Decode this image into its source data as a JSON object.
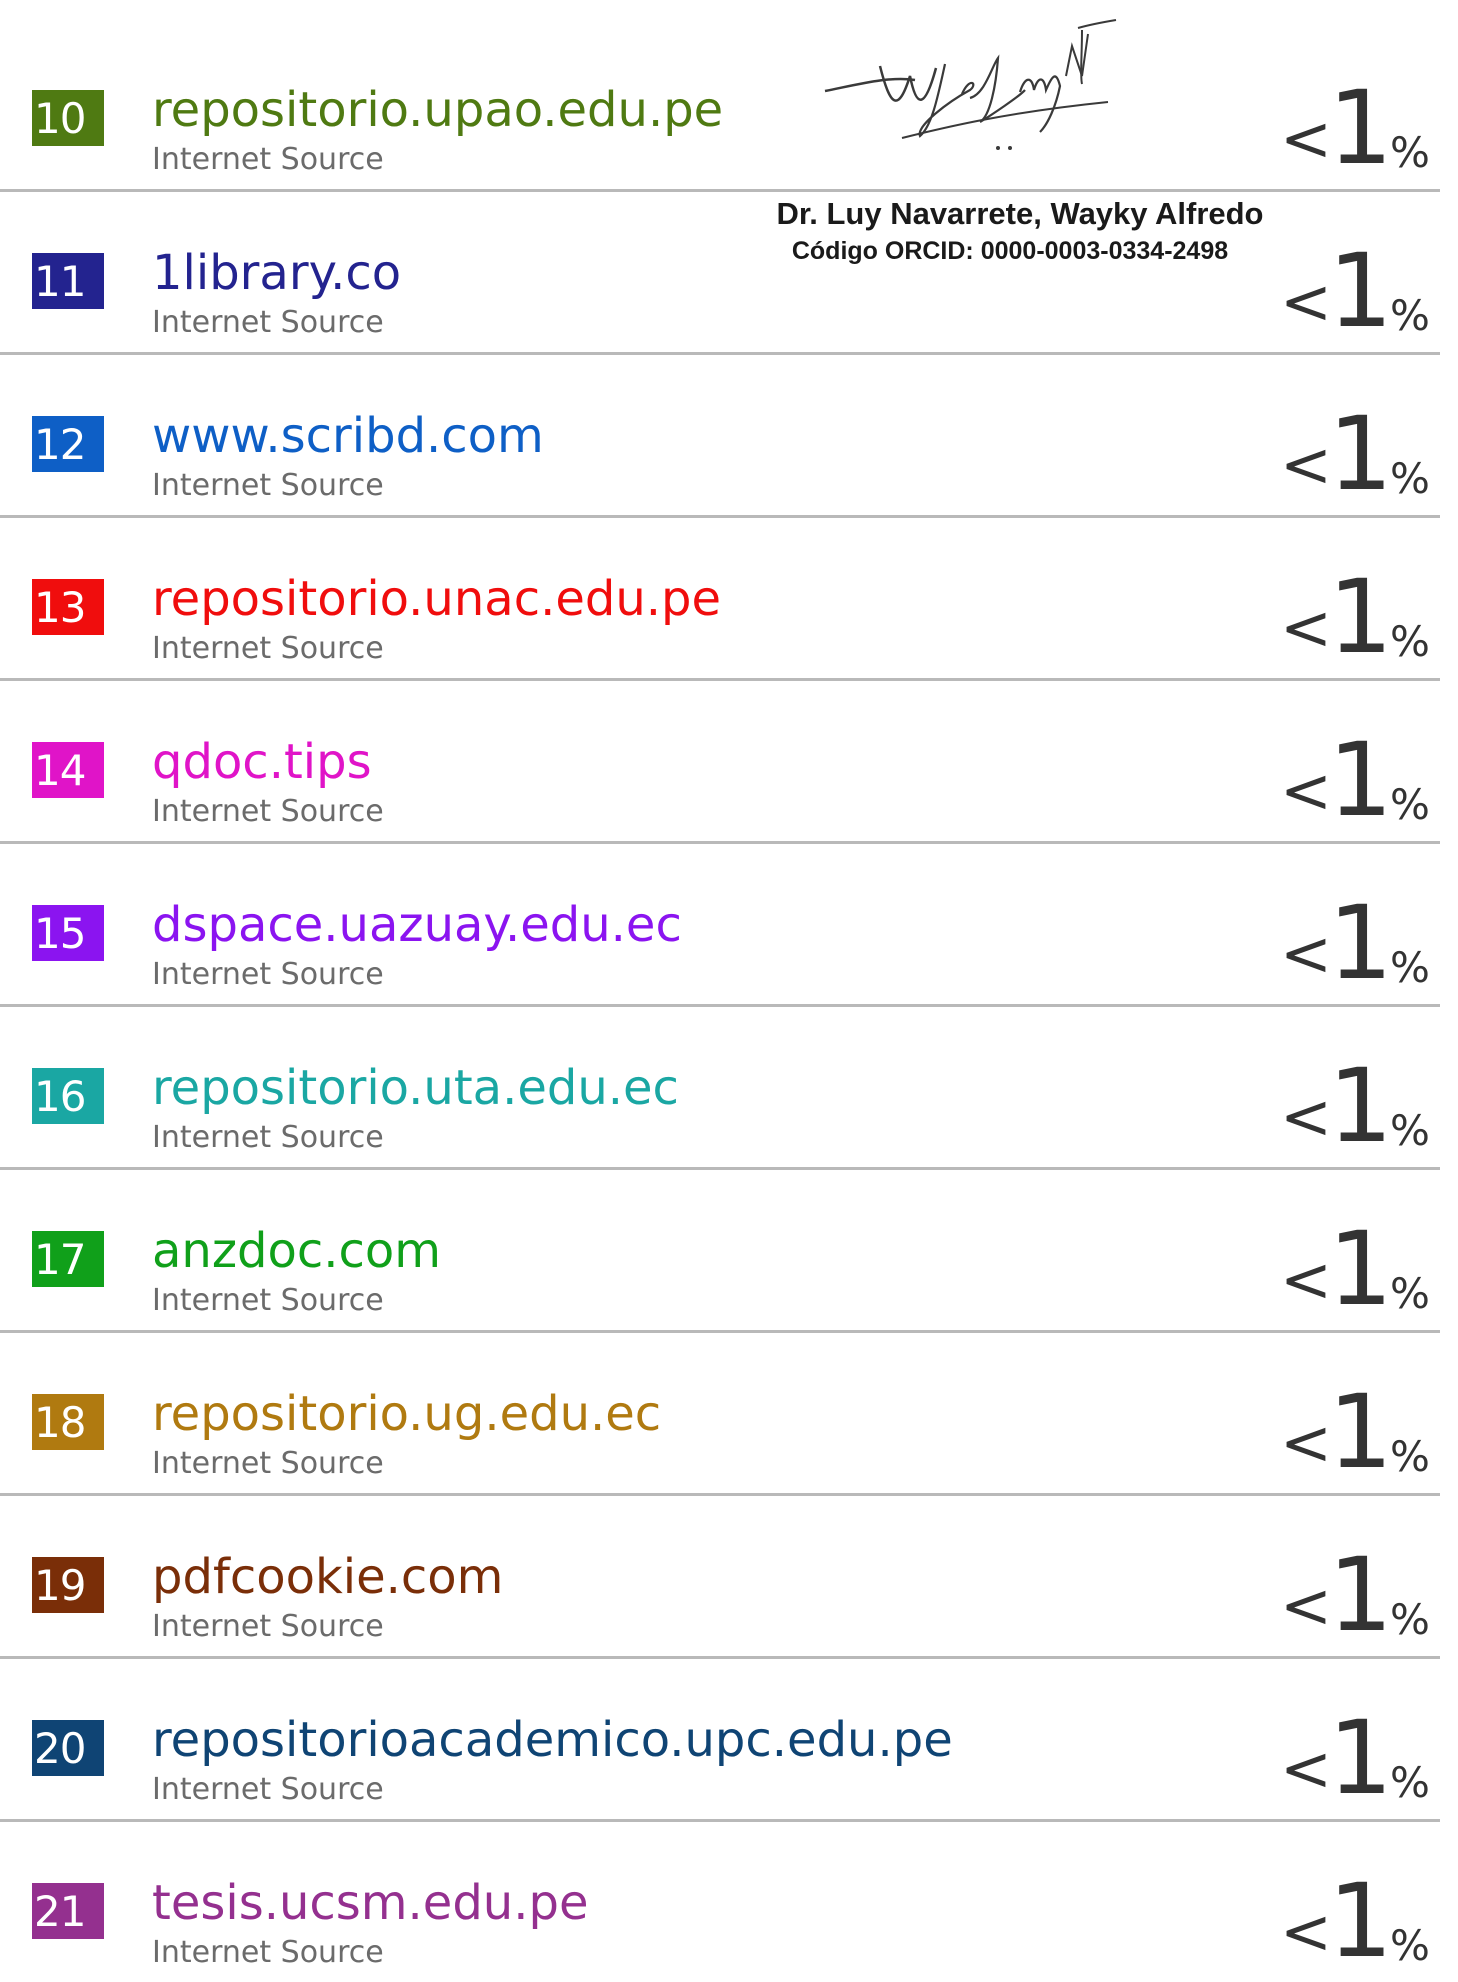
{
  "sources": [
    {
      "rank": "10",
      "name": "repositorio.upao.edu.pe",
      "type": "Internet Source",
      "percent_prefix": "<",
      "percent_value": "1",
      "percent_sign": "%",
      "color": "#4f7a12"
    },
    {
      "rank": "11",
      "name": "1library.co",
      "type": "Internet Source",
      "percent_prefix": "<",
      "percent_value": "1",
      "percent_sign": "%",
      "color": "#23238f"
    },
    {
      "rank": "12",
      "name": "www.scribd.com",
      "type": "Internet Source",
      "percent_prefix": "<",
      "percent_value": "1",
      "percent_sign": "%",
      "color": "#0e5fc6"
    },
    {
      "rank": "13",
      "name": "repositorio.unac.edu.pe",
      "type": "Internet Source",
      "percent_prefix": "<",
      "percent_value": "1",
      "percent_sign": "%",
      "color": "#f00d0d"
    },
    {
      "rank": "14",
      "name": "qdoc.tips",
      "type": "Internet Source",
      "percent_prefix": "<",
      "percent_value": "1",
      "percent_sign": "%",
      "color": "#e014c8"
    },
    {
      "rank": "15",
      "name": "dspace.uazuay.edu.ec",
      "type": "Internet Source",
      "percent_prefix": "<",
      "percent_value": "1",
      "percent_sign": "%",
      "color": "#8b14f0"
    },
    {
      "rank": "16",
      "name": "repositorio.uta.edu.ec",
      "type": "Internet Source",
      "percent_prefix": "<",
      "percent_value": "1",
      "percent_sign": "%",
      "color": "#1aa7a3"
    },
    {
      "rank": "17",
      "name": "anzdoc.com",
      "type": "Internet Source",
      "percent_prefix": "<",
      "percent_value": "1",
      "percent_sign": "%",
      "color": "#10a01a"
    },
    {
      "rank": "18",
      "name": "repositorio.ug.edu.ec",
      "type": "Internet Source",
      "percent_prefix": "<",
      "percent_value": "1",
      "percent_sign": "%",
      "color": "#b07a10"
    },
    {
      "rank": "19",
      "name": "pdfcookie.com",
      "type": "Internet Source",
      "percent_prefix": "<",
      "percent_value": "1",
      "percent_sign": "%",
      "color": "#7a2e08"
    },
    {
      "rank": "20",
      "name": "repositorioacademico.upc.edu.pe",
      "type": "Internet Source",
      "percent_prefix": "<",
      "percent_value": "1",
      "percent_sign": "%",
      "color": "#0f4474"
    },
    {
      "rank": "21",
      "name": "tesis.ucsm.edu.pe",
      "type": "Internet Source",
      "percent_prefix": "<",
      "percent_value": "1",
      "percent_sign": "%",
      "color": "#94308f"
    }
  ],
  "stamp": {
    "signer_name": "Dr. Luy Navarrete, Wayky Alfredo",
    "orcid_line": "Código ORCID: 0000-0003-0334-2498"
  }
}
